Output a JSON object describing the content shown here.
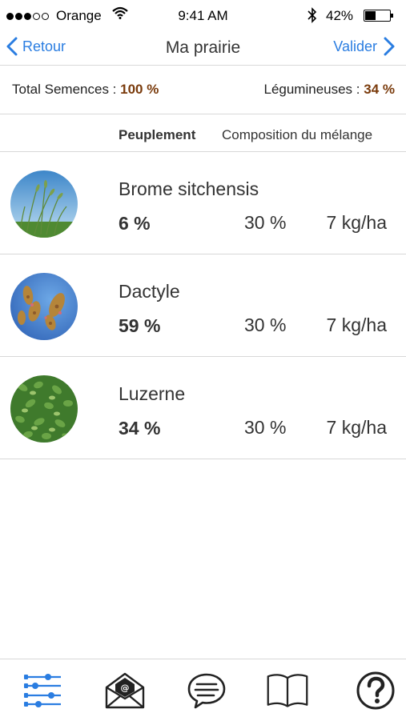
{
  "status_bar": {
    "carrier": "Orange",
    "time": "9:41 AM",
    "battery_pct": "42%",
    "battery_level": 0.42
  },
  "nav": {
    "back_label": "Retour",
    "title": "Ma prairie",
    "validate_label": "Valider"
  },
  "totals": {
    "seeds_label": "Total Semences :",
    "seeds_value": "100 %",
    "legumes_label": "Légumineuses :",
    "legumes_value": "34 %"
  },
  "columns": {
    "peuplement": "Peuplement",
    "composition": "Composition du mélange"
  },
  "species": [
    {
      "name": "Brome sitchensis",
      "peuplement": "6 %",
      "composition": "30 %",
      "dose": "7 kg/ha"
    },
    {
      "name": "Dactyle",
      "peuplement": "59 %",
      "composition": "30 %",
      "dose": "7 kg/ha"
    },
    {
      "name": "Luzerne",
      "peuplement": "34 %",
      "composition": "30 %",
      "dose": "7 kg/ha"
    }
  ],
  "tabs": [
    {
      "icon": "sliders-icon",
      "active": true
    },
    {
      "icon": "mail-icon",
      "active": false
    },
    {
      "icon": "chat-icon",
      "active": false
    },
    {
      "icon": "book-icon",
      "active": false
    },
    {
      "icon": "help-icon",
      "active": false
    }
  ],
  "colors": {
    "accent": "#2a7de1",
    "highlight_value": "#7a3b0c"
  }
}
